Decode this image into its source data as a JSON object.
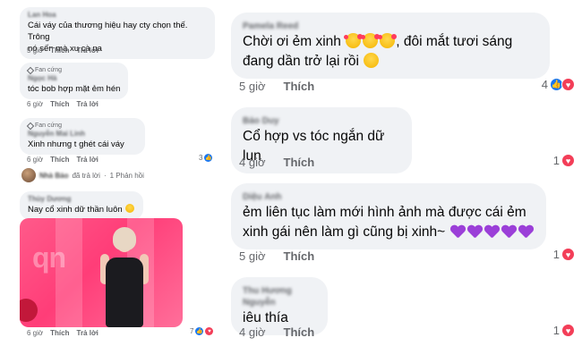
{
  "left_panel": {
    "comments": [
      {
        "name": "Lan Hoa",
        "text_lines": [
          "Cái váy của thương hiệu hay cty chọn thế. Trông",
          "nó sến mà xu cà na"
        ],
        "time": "5 giờ",
        "like": "Thích",
        "reply": "Trả lời"
      },
      {
        "badge": "Fan cứng",
        "name": "Ngọc Hà",
        "text_lines": [
          "tóc bob hợp mặt ẻm hén"
        ],
        "time": "6 giờ",
        "like": "Thích",
        "reply": "Trả lời"
      },
      {
        "badge": "Fan cứng",
        "name": "Nguyễn Mai Linh",
        "text_lines": [
          "Xinh nhưng t ghét cái váy"
        ],
        "time": "6 giờ",
        "like": "Thích",
        "reply": "Trả lời",
        "reaction_count": "3"
      },
      {
        "name": "Thùy Dương",
        "text_lines": [
          "Nay cổ xinh dữ thần luôn"
        ],
        "time": "6 giờ",
        "like": "Thích",
        "reply": "Trả lời",
        "reaction_count": "7"
      }
    ],
    "reply_row": {
      "blurred_name": "Nhà Bảo",
      "suffix": "đã trả lời",
      "separator": "·",
      "replies": "1 Phản hồi"
    },
    "photo": {
      "watermark": "qn"
    }
  },
  "right_panel": {
    "comments": [
      {
        "name": "Pamela Reed",
        "line1": "Chời ơi ẻm xinh",
        "line1_tail": ", đôi mắt tươi sáng",
        "line2": "đang dần trở lại rồi",
        "time": "5 giờ",
        "like": "Thích",
        "reaction_count": "4"
      },
      {
        "name": "Bảo Duy",
        "line1": "Cổ hợp vs tóc ngắn dữ lun",
        "time": "4 giờ",
        "like": "Thích",
        "reaction_count": "1"
      },
      {
        "name": "Diệu Anh",
        "line1": "ẻm liên tục làm mới hình ảnh mà được cái ẻm",
        "line2": "xinh gái nên làm gì cũng bị xinh~",
        "time": "5 giờ",
        "like": "Thích",
        "reaction_count": "1"
      },
      {
        "name": "Thu Hương Nguyễn",
        "line1": "iêu thía",
        "time": "4 giờ",
        "like": "Thích",
        "reaction_count": "1"
      }
    ]
  },
  "colors": {
    "bubble": "#f0f2f5",
    "meta_text": "#65676b",
    "like_blue": "#1877f2",
    "love_red": "#f33e58"
  }
}
